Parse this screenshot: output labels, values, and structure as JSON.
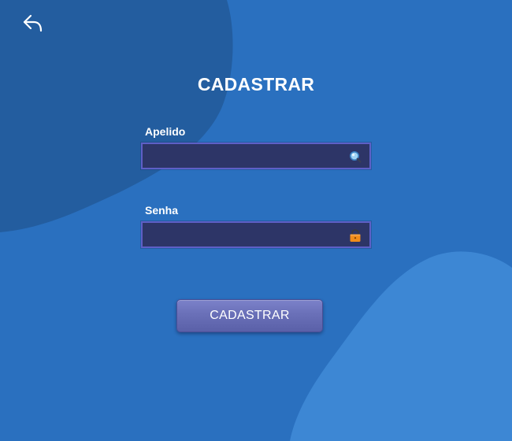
{
  "header": {
    "back_icon": "back-arrow-icon",
    "title": "CADASTRAR"
  },
  "form": {
    "apelido": {
      "label": "Apelido",
      "value": "",
      "icon": "search-icon"
    },
    "senha": {
      "label": "Senha",
      "value": "",
      "icon": "lock-icon"
    },
    "submit_label": "CADASTRAR"
  },
  "colors": {
    "background": "#2a70bf",
    "blob_dark": "#235d9f",
    "blob_light": "#3d87d4",
    "field_background": "#2d3567",
    "field_border": "#5e5fc6",
    "button": "#6a70b8",
    "lock_accent": "#f08c1a"
  }
}
